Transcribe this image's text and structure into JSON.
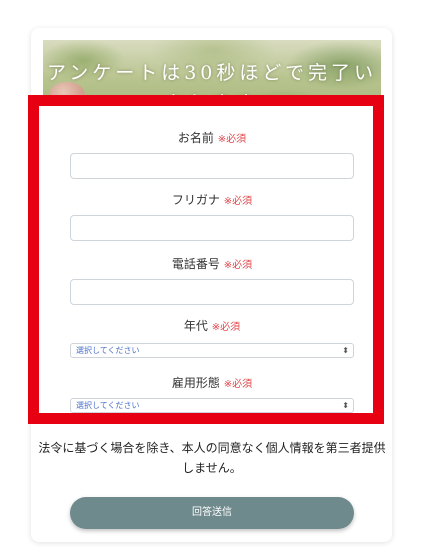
{
  "banner": {
    "title": "アンケートは30秒ほどで完了いたします"
  },
  "form": {
    "fields": [
      {
        "label": "お名前",
        "required": "※必須"
      },
      {
        "label": "フリガナ",
        "required": "※必須"
      },
      {
        "label": "電話番号",
        "required": "※必須"
      },
      {
        "label": "年代",
        "required": "※必須",
        "value": "選択してください"
      },
      {
        "label": "雇用形態",
        "required": "※必須",
        "value": "選択してください"
      }
    ]
  },
  "privacy_notice": "法令に基づく場合を除き、本人の同意なく個人情報を第三者提供しません。",
  "submit_label": "回答送信",
  "colors": {
    "highlight": "#e60012",
    "required": "#e0464a",
    "button": "#6f8a8d",
    "select_text": "#4a6fc9"
  }
}
